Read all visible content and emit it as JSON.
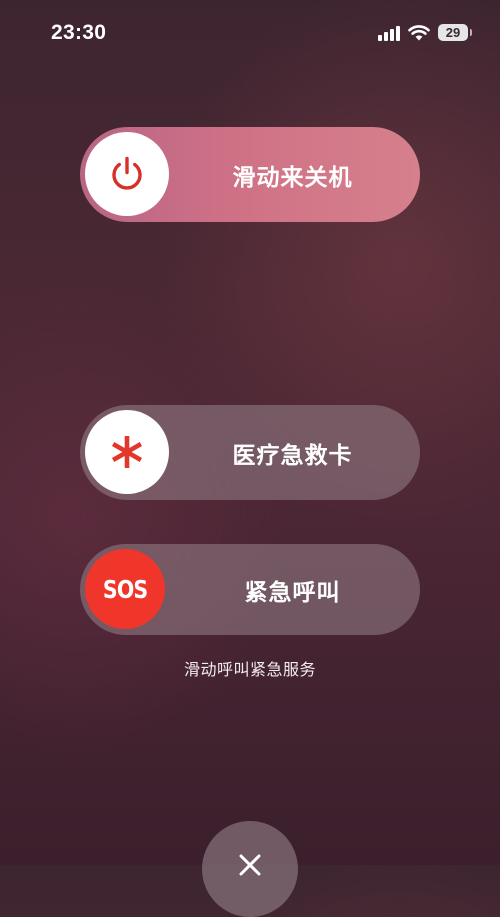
{
  "status_bar": {
    "time": "23:30",
    "battery_level": "29",
    "icons": [
      "cellular-signal-icon",
      "wifi-icon",
      "battery-icon"
    ]
  },
  "power_slider": {
    "label": "滑动来关机",
    "icon": "power-icon",
    "icon_color": "#d7302a"
  },
  "medical_id_slider": {
    "label": "医疗急救卡",
    "icon": "medical-asterisk-icon",
    "icon_color": "#e2382c"
  },
  "emergency_sos_slider": {
    "knob_text": "SOS",
    "label": "紧急呼叫",
    "knob_color": "#f0362b"
  },
  "hint": "滑动呼叫紧急服务",
  "cancel": {
    "icon": "close-icon"
  }
}
